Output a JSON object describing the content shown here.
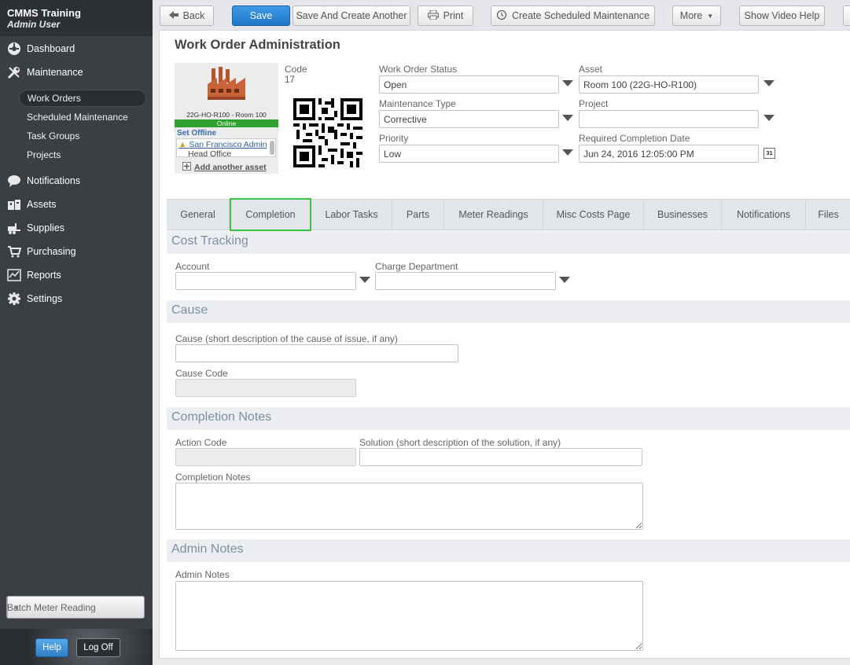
{
  "app": {
    "title": "CMMS Training",
    "user": "Admin User"
  },
  "sidebar": {
    "items": [
      {
        "label": "Dashboard",
        "icon": "dashboard-icon"
      },
      {
        "label": "Maintenance",
        "icon": "wrench-icon"
      },
      {
        "label": "Notifications",
        "icon": "chat-bubble-icon"
      },
      {
        "label": "Assets",
        "icon": "boxes-icon"
      },
      {
        "label": "Supplies",
        "icon": "forklift-icon"
      },
      {
        "label": "Purchasing",
        "icon": "cart-icon"
      },
      {
        "label": "Reports",
        "icon": "chart-icon"
      },
      {
        "label": "Settings",
        "icon": "gear-icon"
      }
    ],
    "subitems": [
      {
        "label": "Work Orders",
        "active": true
      },
      {
        "label": "Scheduled Maintenance"
      },
      {
        "label": "Task Groups"
      },
      {
        "label": "Projects"
      }
    ],
    "batch_label": "Batch Meter Reading",
    "help": "Help",
    "logoff": "Log Off"
  },
  "toolbar": {
    "back": "Back",
    "save": "Save",
    "save_create": "Save And Create Another",
    "print": "Print",
    "create_sched": "Create Scheduled Maintenance",
    "more": "More",
    "video_help": "Show Video Help"
  },
  "page": {
    "title": "Work Order Administration",
    "asset_caption": "22G-HO-R100 - Room 100",
    "online": "Online",
    "set_offline": "Set Offline",
    "asset_list": [
      "San Francisco Admin",
      "Head Office"
    ],
    "add_asset": "Add another asset",
    "code_label": "Code",
    "code_value": "17"
  },
  "fields": {
    "status": {
      "label": "Work Order Status",
      "value": "Open"
    },
    "asset": {
      "label": "Asset",
      "value": "Room 100 (22G-HO-R100)"
    },
    "mtype": {
      "label": "Maintenance Type",
      "value": "Corrective"
    },
    "project": {
      "label": "Project",
      "value": ""
    },
    "priority": {
      "label": "Priority",
      "value": "Low"
    },
    "req_date": {
      "label": "Required Completion Date",
      "value": "Jun 24, 2016 12:05:00 PM",
      "cal": "31"
    }
  },
  "tabs": [
    "General",
    "Completion",
    "Labor Tasks",
    "Parts",
    "Meter Readings",
    "Misc Costs Page",
    "Businesses",
    "Notifications",
    "Files"
  ],
  "sections": {
    "cost": {
      "title": "Cost Tracking",
      "account_label": "Account",
      "charge_label": "Charge Department"
    },
    "cause": {
      "title": "Cause",
      "cause_label": "Cause (short description of the cause of issue, if any)",
      "code_label": "Cause Code"
    },
    "completion": {
      "title": "Completion Notes",
      "action_label": "Action Code",
      "solution_label": "Solution (short description of the solution, if any)",
      "notes_label": "Completion Notes"
    },
    "admin": {
      "title": "Admin Notes",
      "notes_label": "Admin Notes"
    }
  },
  "colors": {
    "accent": "#2a7fd0",
    "online": "#2ea02e",
    "active_tab_border": "#3cc44a"
  }
}
